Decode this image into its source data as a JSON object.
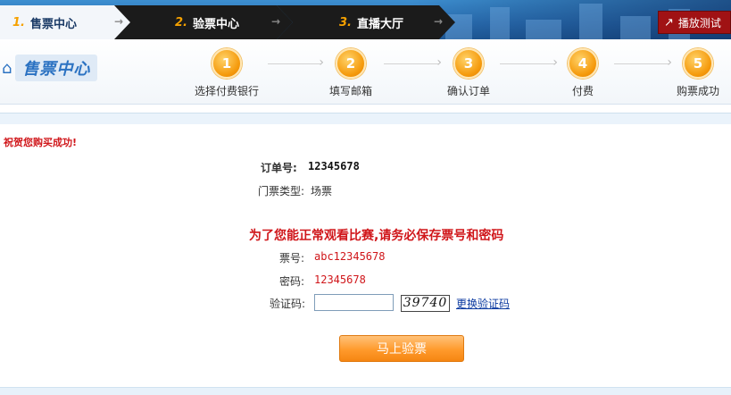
{
  "nav": {
    "tabs": [
      {
        "num": "1.",
        "label": "售票中心"
      },
      {
        "num": "2.",
        "label": "验票中心"
      },
      {
        "num": "3.",
        "label": "直播大厅"
      }
    ],
    "play_test_label": "播放测试"
  },
  "header": {
    "logo_text": "售票中心",
    "steps": [
      {
        "num": "1",
        "label": "选择付费银行"
      },
      {
        "num": "2",
        "label": "填写邮箱"
      },
      {
        "num": "3",
        "label": "确认订单"
      },
      {
        "num": "4",
        "label": "付费"
      },
      {
        "num": "5",
        "label": "购票成功"
      }
    ]
  },
  "main": {
    "congrats": "祝贺您购买成功!",
    "order_label": "订单号:",
    "order_value": "12345678",
    "type_label": "门票类型:",
    "type_value": "场票",
    "notice": "为了您能正常观看比赛,请务必保存票号和密码",
    "ticket_label": "票号:",
    "ticket_value": "abc12345678",
    "password_label": "密码:",
    "password_value": "12345678",
    "verify_label": "验证码:",
    "verify_input_value": "",
    "captcha_text": "39740",
    "change_captcha_label": "更换验证码",
    "submit_label": "马上验票"
  },
  "colors": {
    "accent_red": "#d0161a",
    "step_orange": "#f59a0c",
    "nav_dark": "#1b1b1b",
    "link_blue": "#0b3aa0"
  }
}
